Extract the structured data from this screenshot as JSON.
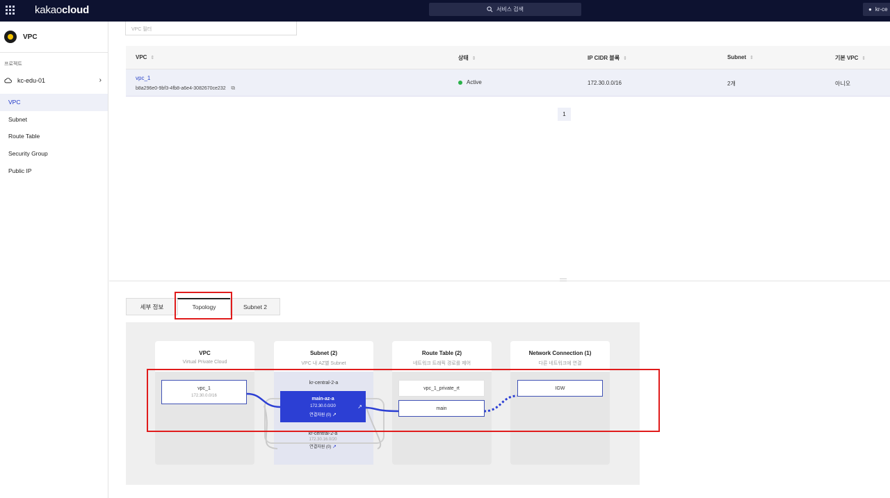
{
  "topbar": {
    "brand_prefix": "kakao",
    "brand_suffix": "cloud",
    "search_label": "서비스 검색",
    "region": "kr-ce"
  },
  "sidebar": {
    "service": "VPC",
    "project_label": "프로젝트",
    "project": "kc-edu-01",
    "items": [
      "VPC",
      "Subnet",
      "Route Table",
      "Security Group",
      "Public IP"
    ],
    "active": "VPC"
  },
  "filter": {
    "placeholder": "VPC 필터"
  },
  "table": {
    "headers": [
      "VPC",
      "상태",
      "IP CIDR 블록",
      "Subnet",
      "기본 VPC"
    ],
    "rows": [
      {
        "name": "vpc_1",
        "id": "b8a296e0-9bf3-4fb8-a6e4-3082670ce232",
        "status": "Active",
        "cidr": "172.30.0.0/16",
        "subnet": "2개",
        "default": "아니오"
      }
    ],
    "status_color": "#2bb14a"
  },
  "pagination": {
    "current": "1"
  },
  "tabs": [
    "세부 정보",
    "Topology",
    "Subnet 2"
  ],
  "active_tab": "Topology",
  "topology": {
    "columns": [
      {
        "title": "VPC",
        "subtitle": "Virtual Private Cloud"
      },
      {
        "title": "Subnet (2)",
        "subtitle": "VPC 내 AZ별 Subnet"
      },
      {
        "title": "Route Table (2)",
        "subtitle": "네트워크 트래픽 경로를 제어"
      },
      {
        "title": "Network Connection (1)",
        "subtitle": "다른 네트워크에 연결"
      }
    ],
    "vpc_node": {
      "name": "vpc_1",
      "cidr": "172.30.0.0/16"
    },
    "subnets": [
      {
        "zone": "kr-central-2-a",
        "name": "main-az-a",
        "cidr": "172.30.0.0/20",
        "conn": "연결자원 (0)"
      },
      {
        "zone": "kr-central-2-a",
        "cidr": "172.30.16.0/20",
        "conn": "연결자원 (0)"
      }
    ],
    "route_tables": [
      "vpc_1_private_rt",
      "main"
    ],
    "connections": [
      "IGW"
    ],
    "accent": "#2c3fd4"
  },
  "highlight_color": "#e01b1b"
}
